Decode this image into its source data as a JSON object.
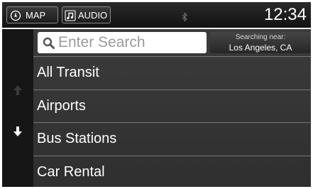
{
  "topbar": {
    "map_label": "MAP",
    "audio_label": "AUDIO",
    "clock": "12:34",
    "map_icon": "compass-icon",
    "audio_icon": "music-note-icon",
    "status_icon": "bluetooth-icon"
  },
  "search": {
    "placeholder": "Enter Search",
    "icon": "search-icon"
  },
  "location": {
    "label": "Searching near:",
    "city": "Los Angeles, CA"
  },
  "list": {
    "items": [
      {
        "label": "All Transit"
      },
      {
        "label": "Airports"
      },
      {
        "label": "Bus Stations"
      },
      {
        "label": "Car Rental"
      }
    ]
  },
  "scroll": {
    "up_icon": "arrow-up-icon",
    "down_icon": "arrow-down-icon",
    "up_enabled": false,
    "down_enabled": true
  },
  "colors": {
    "bar_bg": "#1b1b1b",
    "panel_bg": "#353535",
    "row_divider": "#777777",
    "text": "#ffffff",
    "placeholder": "#9b9b9b"
  }
}
